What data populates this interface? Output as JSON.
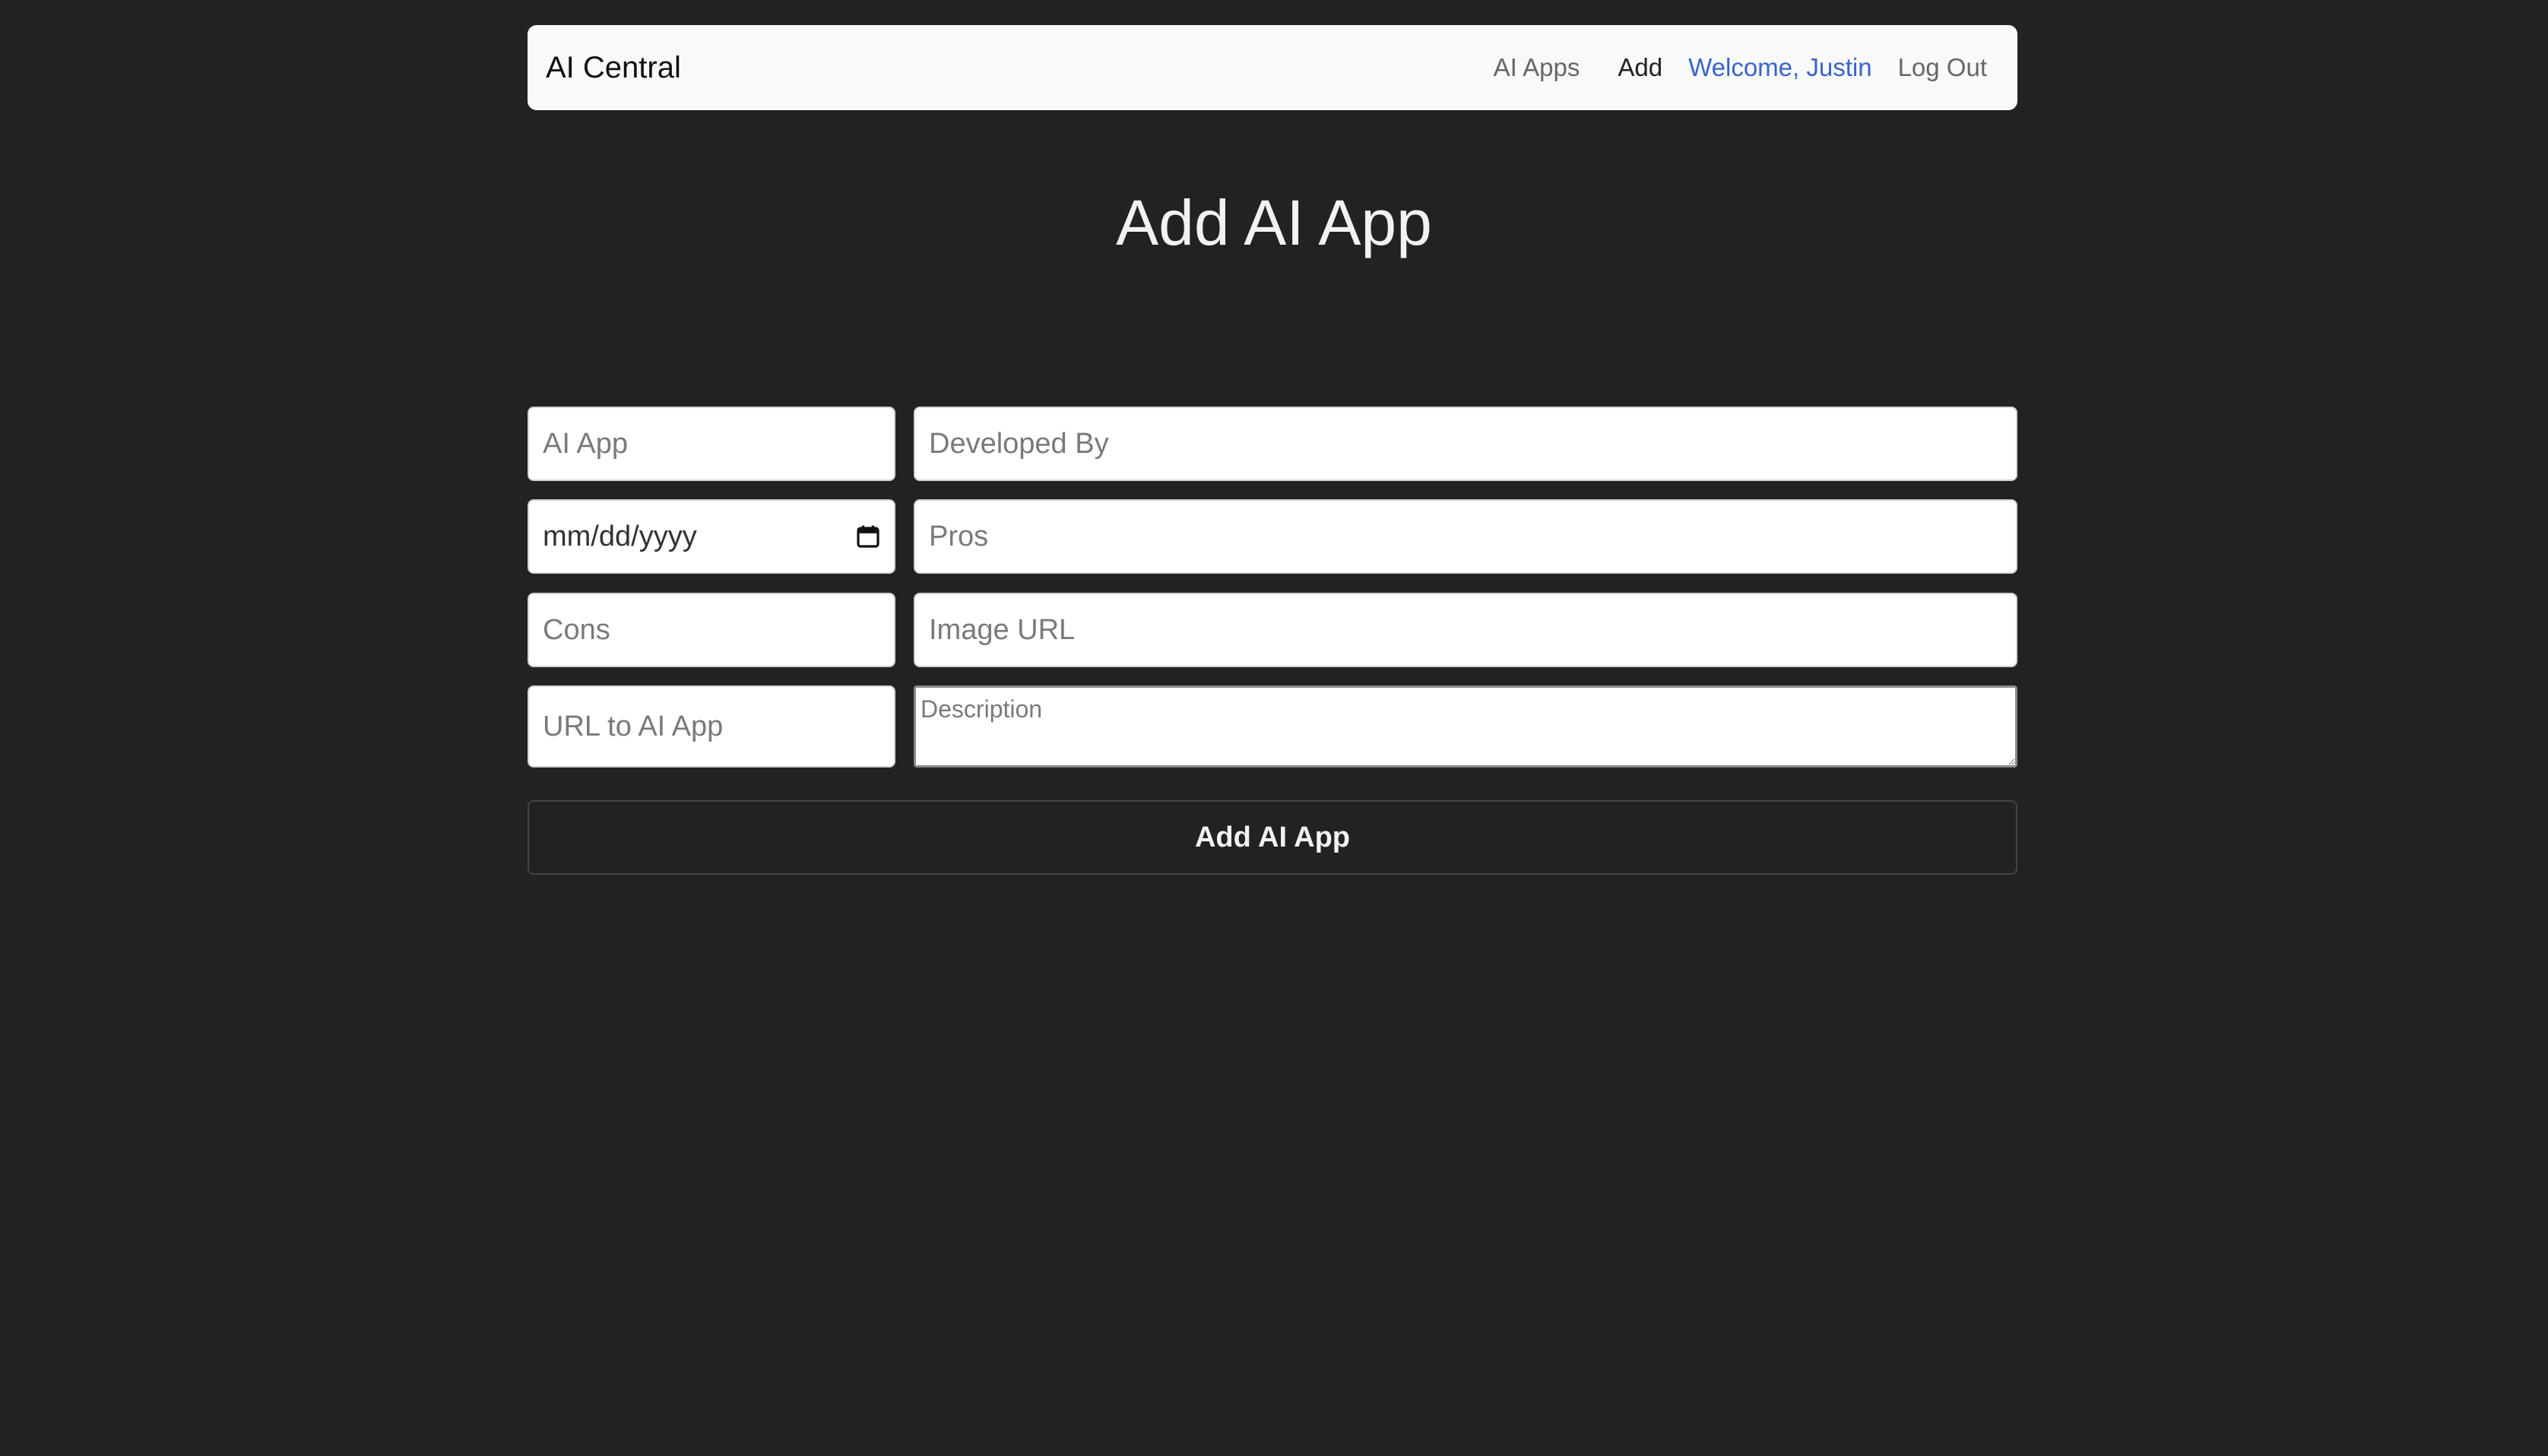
{
  "navbar": {
    "brand": "AI Central",
    "links": {
      "ai_apps": "AI Apps",
      "add": "Add",
      "welcome": "Welcome, Justin",
      "logout": "Log Out"
    }
  },
  "page": {
    "title": "Add AI App"
  },
  "form": {
    "ai_app": {
      "placeholder": "AI App",
      "value": ""
    },
    "developed_by": {
      "placeholder": "Developed By",
      "value": ""
    },
    "release_date": {
      "display": "mm/dd/yyyy"
    },
    "pros": {
      "placeholder": "Pros",
      "value": ""
    },
    "cons": {
      "placeholder": "Cons",
      "value": ""
    },
    "image_url": {
      "placeholder": "Image URL",
      "value": ""
    },
    "app_url": {
      "placeholder": "URL to AI App",
      "value": ""
    },
    "description": {
      "placeholder": "Description",
      "value": ""
    },
    "submit_label": "Add AI App"
  },
  "icons": {
    "date_picker": "calendar-icon"
  },
  "colors": {
    "background": "#222222",
    "navbar": "#f8f9fa",
    "welcome_link": "#3b63c9"
  }
}
